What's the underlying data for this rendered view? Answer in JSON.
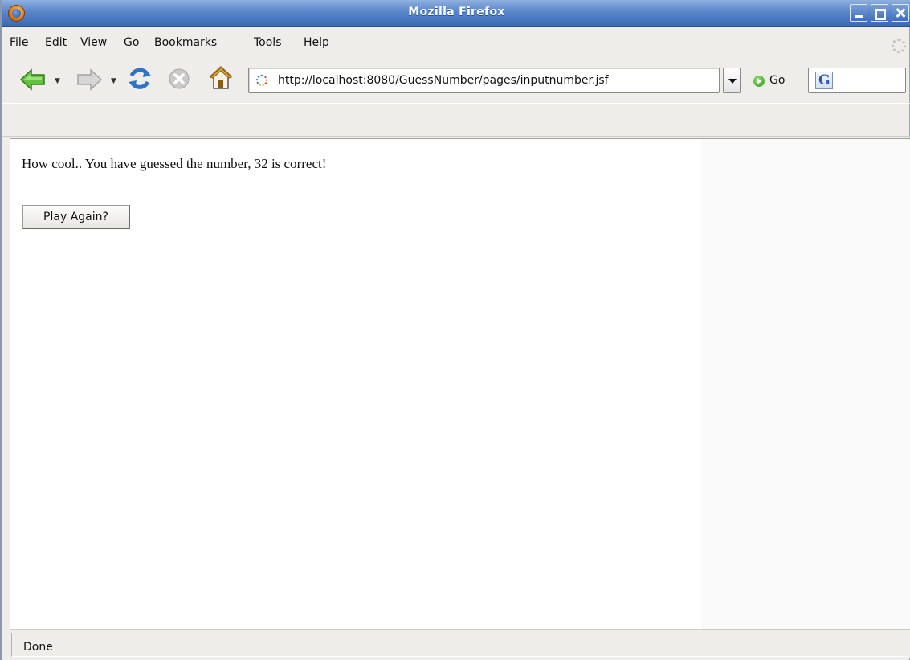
{
  "window": {
    "title": "Mozilla Firefox"
  },
  "menubar": {
    "items": [
      "File",
      "Edit",
      "View",
      "Go",
      "Bookmarks",
      "Tools",
      "Help"
    ]
  },
  "navigation": {
    "url": "http://localhost:8080/GuessNumber/pages/inputnumber.jsf",
    "go_label": "Go",
    "search_engine_glyph": "G",
    "search_value": ""
  },
  "page": {
    "message": "How cool.. You have guessed the number, 32 is correct!",
    "play_again_label": "Play Again?"
  },
  "statusbar": {
    "text": "Done"
  },
  "colors": {
    "titlebar": "#3c6bb5",
    "chrome": "#efedea",
    "content_bg": "#ffffff",
    "go_green": "#2f9a16"
  },
  "icons": [
    "firefox-icon",
    "minimize-icon",
    "maximize-icon",
    "close-icon",
    "back-icon",
    "forward-icon",
    "reload-icon",
    "stop-icon",
    "home-icon",
    "url-favicon",
    "url-dropdown-icon",
    "go-icon",
    "search-engine-icon",
    "throbber-icon"
  ]
}
